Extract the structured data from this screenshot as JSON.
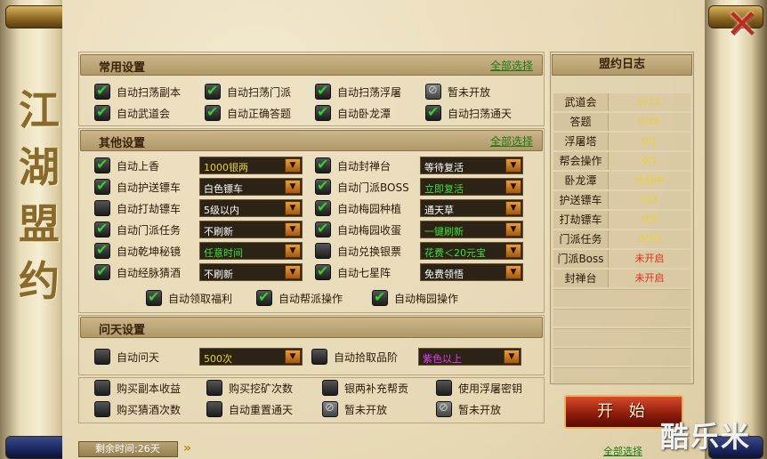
{
  "window_title": "江湖盟约",
  "close_icon": "close-icon",
  "common": {
    "title": "常用设置",
    "select_all": "全部选择",
    "items": [
      {
        "label": "自动扫荡副本",
        "checked": true
      },
      {
        "label": "自动扫荡门派",
        "checked": true
      },
      {
        "label": "自动扫荡浮屠",
        "checked": true
      },
      {
        "label": "暂未开放",
        "checked": false,
        "disabled": true
      },
      {
        "label": "自动武道会",
        "checked": true
      },
      {
        "label": "自动正确答题",
        "checked": true
      },
      {
        "label": "自动卧龙潭",
        "checked": true
      },
      {
        "label": "自动扫荡通天",
        "checked": true
      }
    ]
  },
  "other": {
    "title": "其他设置",
    "select_all": "全部选择",
    "rows": [
      {
        "left": {
          "label": "自动上香",
          "checked": true,
          "value": "1000银两",
          "color": "#e6d23a"
        },
        "right": {
          "label": "自动封禅台",
          "checked": true,
          "value": "等待复活",
          "color": "#ffffff"
        }
      },
      {
        "left": {
          "label": "自动护送镖车",
          "checked": true,
          "value": "白色镖车",
          "color": "#ffffff"
        },
        "right": {
          "label": "自动门派BOSS",
          "checked": true,
          "value": "立即复活",
          "color": "#3ee03e"
        }
      },
      {
        "left": {
          "label": "自动打劫镖车",
          "checked": false,
          "value": "5级以内",
          "color": "#ffffff"
        },
        "right": {
          "label": "自动梅园种植",
          "checked": true,
          "value": "通天草",
          "color": "#ffffff"
        }
      },
      {
        "left": {
          "label": "自动门派任务",
          "checked": true,
          "value": "不刷新",
          "color": "#ffffff"
        },
        "right": {
          "label": "自动梅园收蛋",
          "checked": true,
          "value": "一键刷新",
          "color": "#3ee03e"
        }
      },
      {
        "left": {
          "label": "自动乾坤秘镜",
          "checked": true,
          "value": "任意时间",
          "color": "#3ee03e"
        },
        "right": {
          "label": "自动兑换银票",
          "checked": false,
          "value": "花费＜20元宝",
          "color": "#3ee03e"
        }
      },
      {
        "left": {
          "label": "自动经脉猜酒",
          "checked": true,
          "value": "不刷新",
          "color": "#ffffff"
        },
        "right": {
          "label": "自动七星阵",
          "checked": true,
          "value": "免费领悟",
          "color": "#ffffff"
        }
      }
    ],
    "extra": [
      {
        "label": "自动领取福利",
        "checked": true
      },
      {
        "label": "自动帮派操作",
        "checked": true
      },
      {
        "label": "自动梅园操作",
        "checked": true
      }
    ]
  },
  "wentian": {
    "title": "问天设置",
    "left": {
      "label": "自动问天",
      "checked": false,
      "value": "500次",
      "color": "#e6d23a"
    },
    "right": {
      "label": "自动拾取品阶",
      "checked": false,
      "value": "紫色以上",
      "color": "#e040f0"
    },
    "buys": [
      {
        "label": "购买副本收益",
        "checked": false
      },
      {
        "label": "购买挖矿次数",
        "checked": false
      },
      {
        "label": "银两补充帮贡",
        "checked": false
      },
      {
        "label": "使用浮屠密钥",
        "checked": false
      },
      {
        "label": "购买猜酒次数",
        "checked": false
      },
      {
        "label": "自动重置通天",
        "checked": false
      },
      {
        "label": "暂未开放",
        "checked": false,
        "disabled": true
      },
      {
        "label": "暂未开放",
        "checked": false,
        "disabled": true
      }
    ]
  },
  "journal": {
    "title": "盟约日志",
    "rows": [
      {
        "name": "武道会",
        "value": "0/12",
        "color": "#e6d23a"
      },
      {
        "name": "答题",
        "value": "0/20",
        "color": "#e6d23a"
      },
      {
        "name": "浮屠塔",
        "value": "0/1",
        "color": "#e6d23a"
      },
      {
        "name": "帮会操作",
        "value": "0/1",
        "color": "#e6d23a"
      },
      {
        "name": "卧龙潭",
        "value": "开启中",
        "color": "#e6d23a"
      },
      {
        "name": "护送镖车",
        "value": "0/3",
        "color": "#e6d23a"
      },
      {
        "name": "打劫镖车",
        "value": "0/5",
        "color": "#e6d23a"
      },
      {
        "name": "门派任务",
        "value": "0/20",
        "color": "#e6d23a"
      },
      {
        "name": "门派Boss",
        "value": "未开启",
        "color": "#e02a1a"
      },
      {
        "name": "封禅台",
        "value": "未开启",
        "color": "#e02a1a"
      }
    ]
  },
  "start_button": "开 始",
  "remaining_time": "剩余时间:26天",
  "bottom_select_all": "全部选择",
  "watermark": "酷乐米"
}
